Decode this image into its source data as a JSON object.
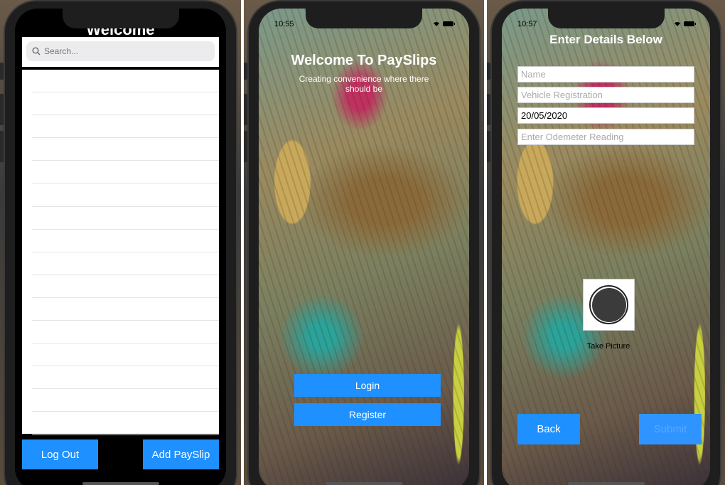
{
  "screen1": {
    "title": "Welcome",
    "search_placeholder": "Search...",
    "row_count": 16,
    "logout_label": "Log Out",
    "add_label": "Add PaySlip"
  },
  "screen2": {
    "time": "10:55",
    "title": "Welcome To PaySlips",
    "subtitle": "Creating convenience where there should be",
    "login_label": "Login",
    "register_label": "Register"
  },
  "screen3": {
    "time": "10:57",
    "title": "Enter Details Below",
    "name_placeholder": "Name",
    "registration_placeholder": "Vehicle Registration",
    "date_value": "20/05/2020",
    "odometer_placeholder": "Enter Odemeter Reading",
    "take_picture_label": "Take Picture",
    "back_label": "Back",
    "submit_label": "Submit"
  },
  "colors": {
    "accent": "#1e90ff",
    "bezel": "#1e1e1e"
  }
}
